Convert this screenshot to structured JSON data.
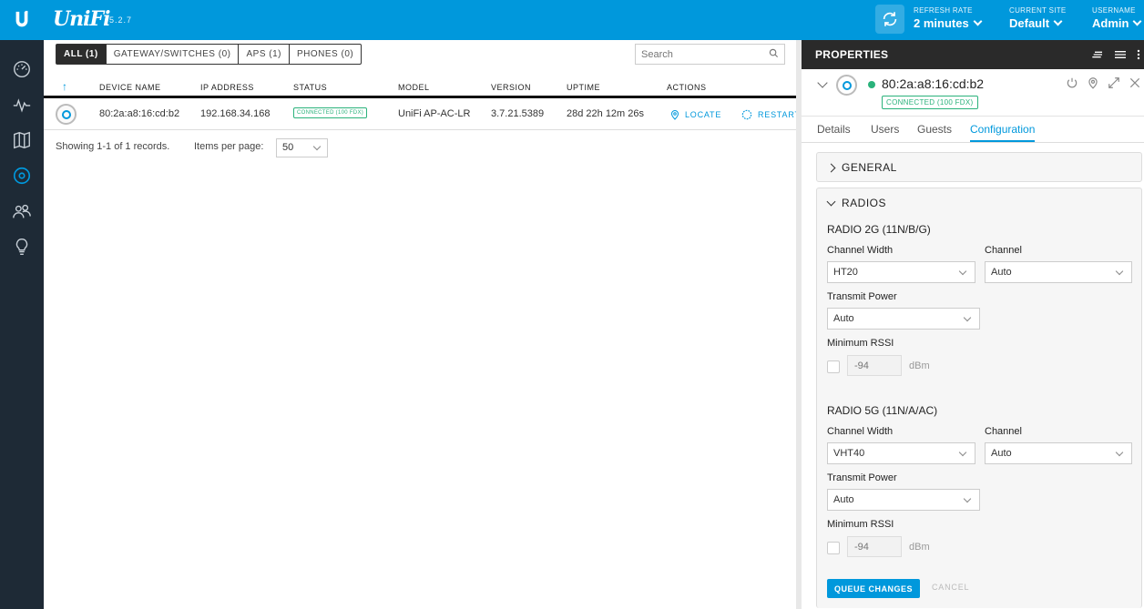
{
  "app": {
    "brand": "UniFi",
    "version": "5.2.7"
  },
  "topbar": {
    "refresh_rate_label": "REFRESH RATE",
    "refresh_rate_value": "2 minutes",
    "current_site_label": "CURRENT SITE",
    "current_site_value": "Default",
    "username_label": "USERNAME",
    "username_value": "Admin"
  },
  "sidebar": {
    "items": [
      {
        "icon": "dashboard-icon"
      },
      {
        "icon": "statistics-icon"
      },
      {
        "icon": "map-icon"
      },
      {
        "icon": "devices-icon",
        "active": true
      },
      {
        "icon": "clients-icon"
      },
      {
        "icon": "insights-icon"
      }
    ]
  },
  "filters": [
    {
      "label": "ALL (1)",
      "active": true
    },
    {
      "label": "GATEWAY/SWITCHES (0)"
    },
    {
      "label": "APS (1)"
    },
    {
      "label": "PHONES (0)"
    }
  ],
  "search": {
    "placeholder": "Search"
  },
  "table": {
    "sort_arrow": "↑",
    "columns": [
      "DEVICE NAME",
      "IP ADDRESS",
      "STATUS",
      "MODEL",
      "VERSION",
      "UPTIME",
      "ACTIONS"
    ],
    "rows": [
      {
        "device_name": "80:2a:a8:16:cd:b2",
        "ip_address": "192.168.34.168",
        "status": "CONNECTED (100 FDX)",
        "model": "UniFi AP-AC-LR",
        "version": "3.7.21.5389",
        "uptime": "28d 22h 12m 26s",
        "action_locate": "LOCATE",
        "action_restart": "RESTART"
      }
    ]
  },
  "pagination": {
    "showing": "Showing 1-1 of 1 records.",
    "items_per_page_label": "Items per page:",
    "items_per_page_value": "50"
  },
  "properties": {
    "title": "PROPERTIES",
    "device_name": "80:2a:a8:16:cd:b2",
    "status_badge": "CONNECTED (100 FDX)",
    "tabs": [
      "Details",
      "Users",
      "Guests",
      "Configuration"
    ],
    "active_tab": "Configuration",
    "sections": {
      "general": "GENERAL",
      "radios": "RADIOS"
    },
    "radio_2g": {
      "title": "RADIO 2G (11N/B/G)",
      "channel_width_label": "Channel Width",
      "channel_width_value": "HT20",
      "channel_label": "Channel",
      "channel_value": "Auto",
      "transmit_power_label": "Transmit Power",
      "transmit_power_value": "Auto",
      "min_rssi_label": "Minimum RSSI",
      "min_rssi_placeholder": "-94",
      "min_rssi_unit": "dBm"
    },
    "radio_5g": {
      "title": "RADIO 5G (11N/A/AC)",
      "channel_width_label": "Channel Width",
      "channel_width_value": "VHT40",
      "channel_label": "Channel",
      "channel_value": "Auto",
      "transmit_power_label": "Transmit Power",
      "transmit_power_value": "Auto",
      "min_rssi_label": "Minimum RSSI",
      "min_rssi_placeholder": "-94",
      "min_rssi_unit": "dBm"
    },
    "buttons": {
      "queue": "QUEUE CHANGES",
      "cancel": "CANCEL"
    }
  },
  "colors": {
    "brand_blue": "#0098dc",
    "sidebar": "#1e2a36",
    "connected_green": "#2ab27b",
    "panel_header": "#2a2a2a"
  }
}
